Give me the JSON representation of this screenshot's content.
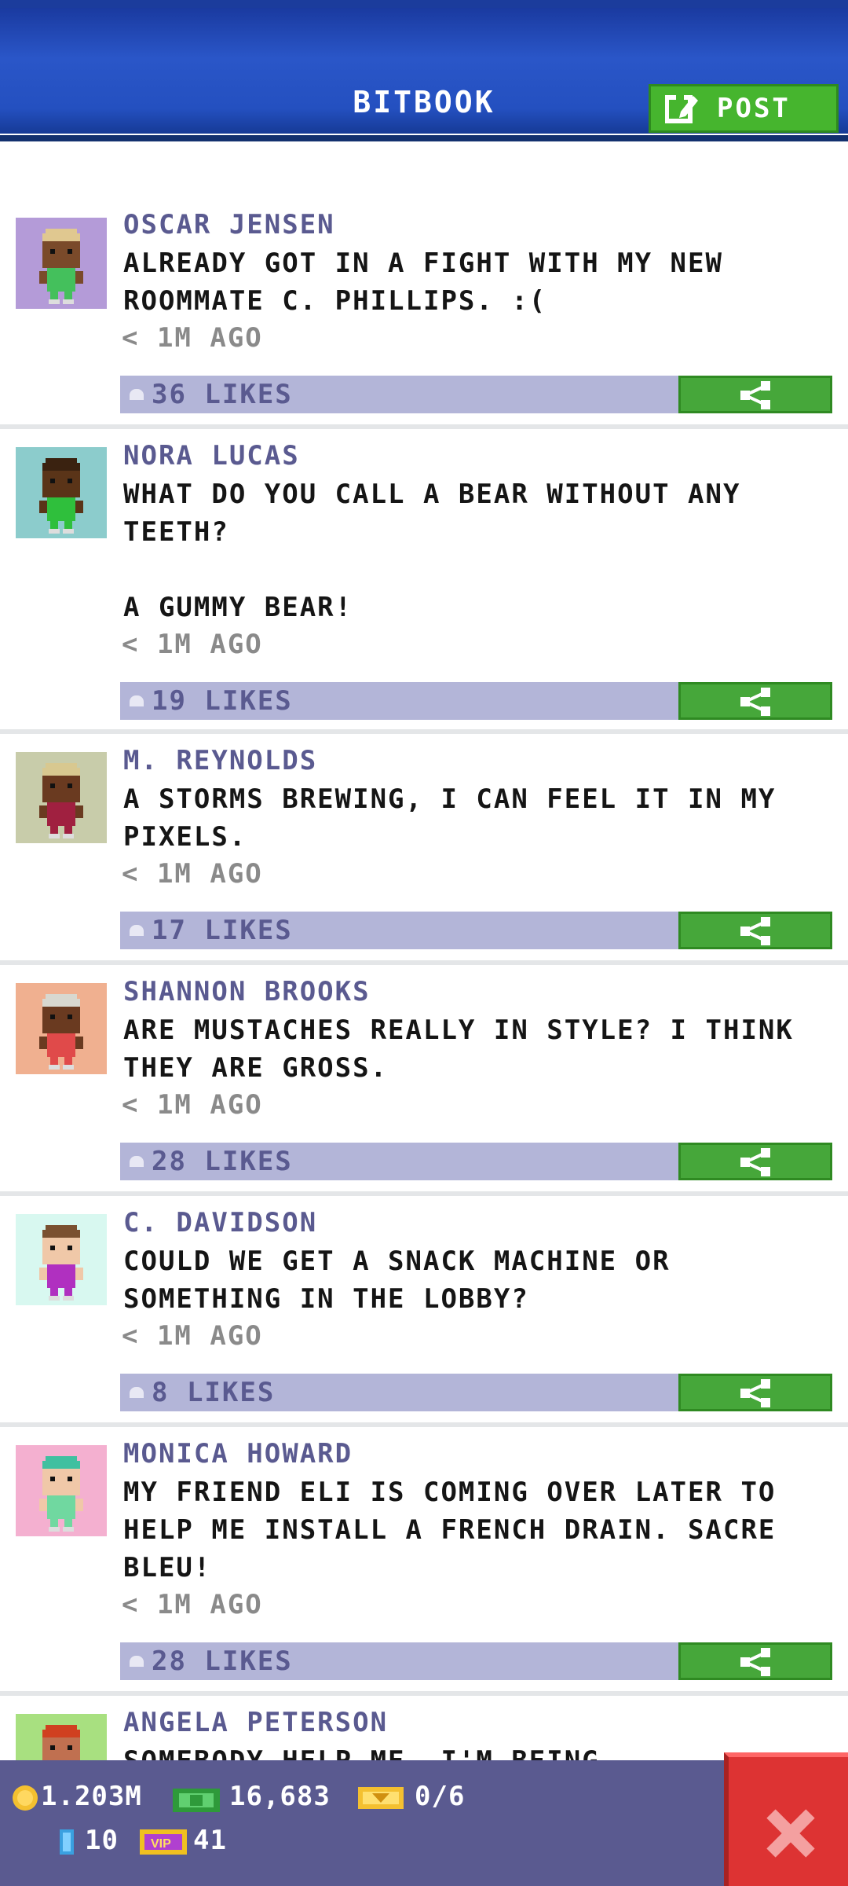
{
  "header": {
    "title": "BITBOOK",
    "post_label": "POST"
  },
  "posts": [
    {
      "name": "OSCAR JENSEN",
      "text": "ALREADY GOT IN A FIGHT WITH MY NEW\nROOMMATE C. PHILLIPS. :(",
      "time": "< 1M AGO",
      "likes": "36 LIKES",
      "bg": "#b49bd8",
      "skin": "#7a4a2a",
      "hair": "#e0c890",
      "shirt": "#44c05c"
    },
    {
      "name": "NORA LUCAS",
      "text": "WHAT DO YOU CALL A BEAR WITHOUT ANY\nTEETH?\n\nA GUMMY BEAR!",
      "time": "< 1M AGO",
      "likes": "19 LIKES",
      "bg": "#8ccccc",
      "skin": "#5a3418",
      "hair": "#3a2210",
      "shirt": "#2fbf3c"
    },
    {
      "name": "M. REYNOLDS",
      "text": "A STORMS BREWING, I CAN FEEL IT IN MY\nPIXELS.",
      "time": "< 1M AGO",
      "likes": "17 LIKES",
      "bg": "#c8ccaa",
      "skin": "#6a3a20",
      "hair": "#d8c890",
      "shirt": "#a02040"
    },
    {
      "name": "SHANNON BROOKS",
      "text": "ARE MUSTACHES REALLY IN STYLE? I THINK\nTHEY ARE GROSS.",
      "time": "< 1M AGO",
      "likes": "28 LIKES",
      "bg": "#f0b090",
      "skin": "#6a3a20",
      "hair": "#d8d8d0",
      "shirt": "#e04a4a"
    },
    {
      "name": "C. DAVIDSON",
      "text": "COULD WE GET A SNACK MACHINE OR\nSOMETHING IN THE LOBBY?",
      "time": "< 1M AGO",
      "likes": "8 LIKES",
      "bg": "#d8f8f0",
      "skin": "#f0c8a8",
      "hair": "#7a5030",
      "shirt": "#b030c0"
    },
    {
      "name": "MONICA HOWARD",
      "text": "MY FRIEND ELI IS COMING OVER LATER TO\nHELP ME INSTALL A FRENCH DRAIN. SACRE\nBLEU!",
      "time": "< 1M AGO",
      "likes": "28 LIKES",
      "bg": "#f4b0d0",
      "skin": "#f0c8a8",
      "hair": "#40c0a0",
      "shirt": "#70d8a0"
    },
    {
      "name": "ANGELA PETERSON",
      "text": "SOMEBODY HELP ME, I'M BEING...",
      "time": "",
      "likes": "",
      "bg": "#a8e080",
      "skin": "#c07050",
      "hair": "#d04020",
      "shirt": "#4060c0"
    }
  ],
  "status": {
    "coins": "1.203M",
    "cash": "16,683",
    "tickets": "0/6",
    "bux": "10",
    "vip": "41"
  },
  "colors": {
    "header": "#2a56c8",
    "accent_green": "#46a73a",
    "like_bar": "#b3b5d8",
    "status_bar": "#5a5a90",
    "close": "#dd3333"
  },
  "icons": {
    "post": "edit-icon",
    "like": "thumb-icon",
    "share": "share-icon",
    "close": "close-icon",
    "coin": "coin-icon",
    "cash": "cash-icon",
    "ticket": "ticket-icon",
    "bux": "bux-icon",
    "vip": "vip-icon"
  }
}
